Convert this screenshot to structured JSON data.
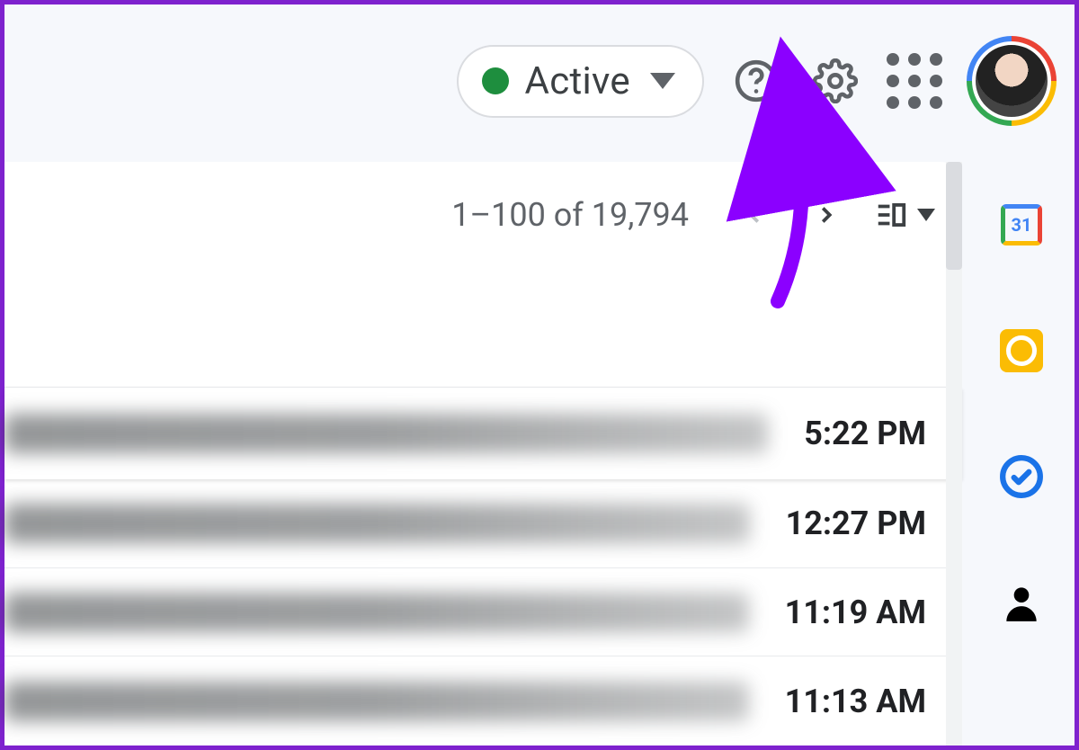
{
  "header": {
    "status_label": "Active",
    "status_color": "#1e8e3e"
  },
  "list": {
    "counter": "1–100 of 19,794",
    "rows": [
      {
        "time": "5:22 PM"
      },
      {
        "time": "12:27 PM"
      },
      {
        "time": "11:19 AM"
      },
      {
        "time": "11:13 AM"
      }
    ]
  },
  "side_panel": {
    "calendar_day": "31"
  }
}
